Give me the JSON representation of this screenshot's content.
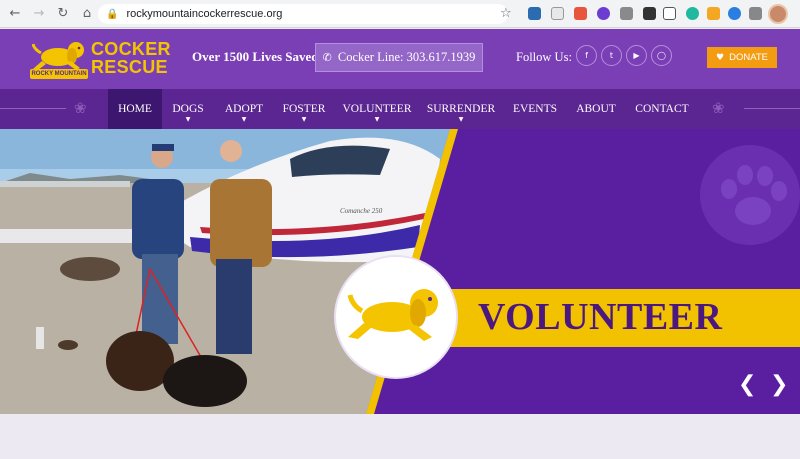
{
  "browser": {
    "url": "rockymountaincockerrescue.org",
    "icons": [
      "back-icon",
      "forward-icon",
      "reload-icon",
      "home-icon",
      "lock-icon",
      "bookmark-star-icon"
    ]
  },
  "header": {
    "logo": {
      "line1": "COCKER",
      "line2": "RESCUE",
      "badge": "ROCKY MOUNTAIN"
    },
    "tagline": "Over 1500 Lives Saved !",
    "cocker_line": "Cocker Line: 303.617.1939",
    "follow_label": "Follow Us:",
    "social": [
      "facebook-icon",
      "twitter-icon",
      "youtube-icon",
      "instagram-icon"
    ],
    "donate_label": "DONATE"
  },
  "nav": {
    "items": [
      {
        "label": "HOME",
        "active": true,
        "dropdown": false
      },
      {
        "label": "DOGS",
        "active": false,
        "dropdown": true
      },
      {
        "label": "ADOPT",
        "active": false,
        "dropdown": true
      },
      {
        "label": "FOSTER",
        "active": false,
        "dropdown": true
      },
      {
        "label": "VOLUNTEER",
        "active": false,
        "dropdown": true
      },
      {
        "label": "SURRENDER",
        "active": false,
        "dropdown": true
      },
      {
        "label": "EVENTS",
        "active": false,
        "dropdown": false
      },
      {
        "label": "ABOUT",
        "active": false,
        "dropdown": false
      },
      {
        "label": "CONTACT",
        "active": false,
        "dropdown": false
      }
    ]
  },
  "hero": {
    "banner_text": "VOLUNTEER",
    "plane_lettering": "Comanche 250",
    "prev_icon": "chevron-left-icon",
    "next_icon": "chevron-right-icon"
  },
  "colors": {
    "header_purple": "#7b3fb5",
    "nav_purple": "#5b2592",
    "hero_purple": "#5a1fa0",
    "accent_yellow": "#f2c200",
    "donate_orange": "#f39c12"
  }
}
